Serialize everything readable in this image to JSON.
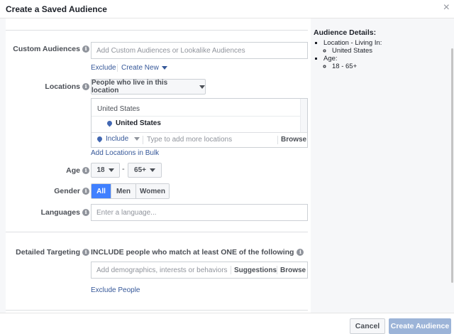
{
  "dialog": {
    "title": "Create a Saved Audience",
    "close_glyph": "×"
  },
  "custom_audiences": {
    "label": "Custom Audiences",
    "placeholder": "Add Custom Audiences or Lookalike Audiences",
    "exclude_link": "Exclude",
    "create_new_link": "Create New"
  },
  "locations": {
    "label": "Locations",
    "dropdown": "People who live in this location",
    "group_header": "United States",
    "selected": "United States",
    "include_label": "Include",
    "search_placeholder": "Type to add more locations",
    "browse": "Browse",
    "bulk_link": "Add Locations in Bulk"
  },
  "age": {
    "label": "Age",
    "min": "18",
    "separator": "-",
    "max": "65+"
  },
  "gender": {
    "label": "Gender",
    "options": [
      "All",
      "Men",
      "Women"
    ],
    "selected": "All"
  },
  "languages": {
    "label": "Languages",
    "placeholder": "Enter a language..."
  },
  "detailed_targeting": {
    "label": "Detailed Targeting",
    "include_text": "INCLUDE people who match at least ONE of the following",
    "placeholder": "Add demographics, interests or behaviors",
    "suggestions": "Suggestions",
    "browse": "Browse",
    "exclude_link": "Exclude People"
  },
  "audience_details": {
    "title": "Audience Details:",
    "location_label": "Location - Living In:",
    "location_value": "United States",
    "age_label": "Age:",
    "age_value": "18 - 65+"
  },
  "footer": {
    "cancel": "Cancel",
    "create": "Create Audience"
  },
  "colors": {
    "accent": "#4080ff",
    "link": "#365899",
    "create_button_disabled": "#9cb4d8"
  }
}
